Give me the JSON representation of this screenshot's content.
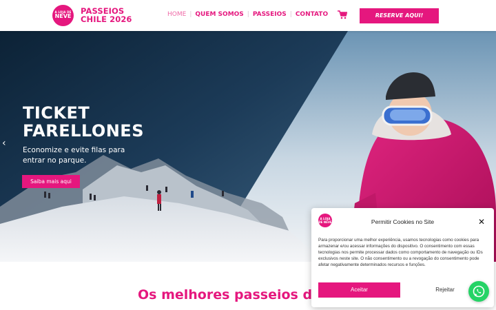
{
  "brand": {
    "badge_small": "A LOJA DE",
    "badge_big": "NEVE",
    "name_line1": "PASSEIOS",
    "name_line2": "CHILE 2026",
    "color": "#e5177e"
  },
  "nav": {
    "items": [
      {
        "label": "HOME",
        "active": true
      },
      {
        "label": "QUEM SOMOS"
      },
      {
        "label": "PASSEIOS"
      },
      {
        "label": "CONTATO"
      }
    ],
    "separator": "|",
    "cart_icon": "cart-icon",
    "cta_label": "RESERVE AQUI!"
  },
  "hero": {
    "title_line1": "TICKET",
    "title_line2": "FARELLONES",
    "subtitle": "Economize e evite filas para entrar no parque.",
    "button_label": "Saiba mais aqui",
    "prev_arrow": "‹"
  },
  "section": {
    "title": "Os melhores passeios do"
  },
  "cookie": {
    "logo_small": "A LOJA DE NEVE",
    "title": "Permitir Cookies no Site",
    "close": "✕",
    "body": "Para proporcionar uma melhor experiência, usamos tecnologias como cookies para armazenar e/ou acessar informações do dispositivo. O consentimento com essas tecnologias nos permite processar dados como comportamento de navegação ou IDs exclusivos neste site. O não consentimento ou a revogação do consentimento pode afetar negativamente determinados recursos e funções.",
    "accept_label": "Aceitar",
    "reject_label": "Rejeitar"
  },
  "whatsapp": {
    "icon": "whatsapp-icon",
    "color": "#25d366"
  }
}
